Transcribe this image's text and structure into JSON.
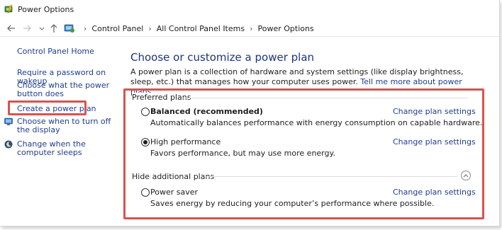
{
  "window": {
    "title": "Power Options"
  },
  "nav": {
    "back_icon": "back-arrow-icon",
    "forward_icon": "forward-arrow-icon",
    "recent_icon": "chevron-down-icon",
    "up_icon": "up-arrow-icon",
    "breadcrumbs": [
      "Control Panel",
      "All Control Panel Items",
      "Power Options"
    ]
  },
  "sidebar": {
    "home": "Control Panel Home",
    "items": [
      "Require a password on wakeup",
      "Choose what the power button does",
      "Create a power plan",
      "Choose when to turn off the display",
      "Change when the computer sleeps"
    ]
  },
  "main": {
    "title": "Choose or customize a power plan",
    "description": "A power plan is a collection of hardware and system settings (like display brightness, sleep, etc.) that manages how your computer uses power.",
    "description_link": "Tell me more about power plans",
    "preferred_label": "Preferred plans",
    "hide_label": "Hide additional plans",
    "change_label": "Change plan settings",
    "plans": [
      {
        "name": "Balanced (recommended)",
        "desc": "Automatically balances performance with energy consumption on capable hardware.",
        "selected": false
      },
      {
        "name": "High performance",
        "desc": "Favors performance, but may use more energy.",
        "selected": true
      },
      {
        "name": "Power saver",
        "desc": "Saves energy by reducing your computer’s performance where possible.",
        "selected": false
      }
    ]
  },
  "colors": {
    "link": "#1e3d8f",
    "heading": "#1e3287",
    "highlight": "#d9534f"
  }
}
